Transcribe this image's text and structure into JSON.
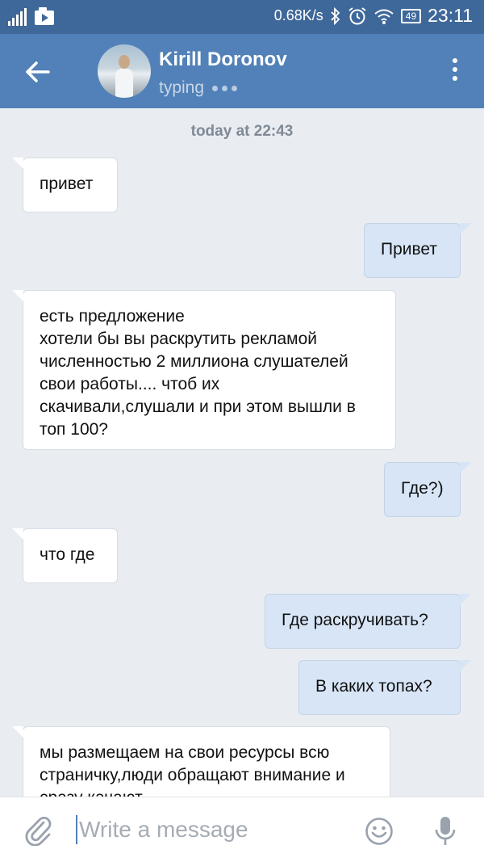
{
  "status_bar": {
    "network_speed": "0.68K/s",
    "battery": "49",
    "time": "23:11"
  },
  "header": {
    "name": "Kirill Doronov",
    "status": "typing"
  },
  "chat": {
    "date_separator": "today at 22:43",
    "messages": [
      {
        "direction": "in",
        "text": "привет"
      },
      {
        "direction": "out",
        "text": "Привет"
      },
      {
        "direction": "in",
        "text": "есть предложение\nхотели бы вы раскрутить рекламой численностью 2 миллиона слушателей свои работы.... чтоб их скачивали,слушали и при этом вышли в топ 100?"
      },
      {
        "direction": "out",
        "text": "Где?)"
      },
      {
        "direction": "in",
        "text": "что где"
      },
      {
        "direction": "out",
        "text": "Где раскручивать?"
      },
      {
        "direction": "out",
        "text": "В каких топах?"
      },
      {
        "direction": "in",
        "text": "мы размещаем на свои ресурсы всю страничку,люди обращают внимание и сразу качают"
      }
    ]
  },
  "input": {
    "placeholder": "Write a message",
    "value": ""
  },
  "icons": {
    "back": "arrow-left-icon",
    "more": "more-vertical-icon",
    "attach": "paperclip-icon",
    "emoji": "smiley-icon",
    "mic": "microphone-icon"
  },
  "colors": {
    "header": "#5181b8",
    "status_bar": "#3f689a",
    "chat_bg": "#e9edf1",
    "outgoing_bubble": "#d7e5f6",
    "incoming_bubble": "#ffffff"
  }
}
